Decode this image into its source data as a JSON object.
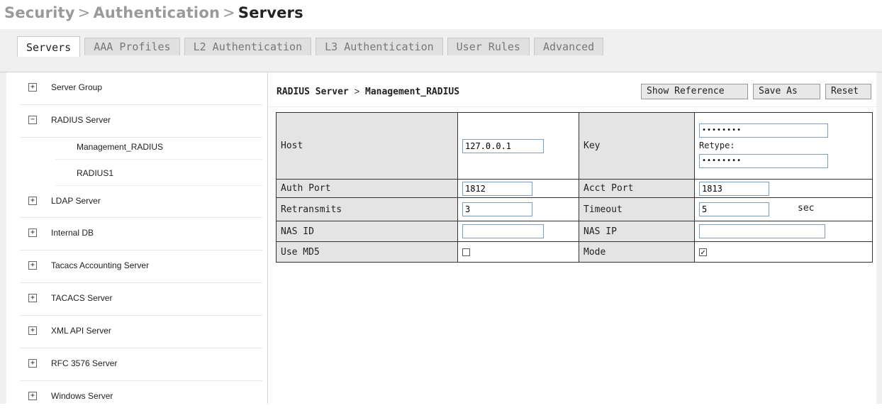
{
  "breadcrumb": {
    "part1": "Security",
    "sep1": ">",
    "part2": "Authentication",
    "sep2": ">",
    "current": "Servers"
  },
  "tabs": [
    {
      "label": "Servers",
      "active": true
    },
    {
      "label": "AAA Profiles"
    },
    {
      "label": "L2 Authentication"
    },
    {
      "label": "L3 Authentication"
    },
    {
      "label": "User Rules"
    },
    {
      "label": "Advanced"
    }
  ],
  "tree": {
    "server_group": {
      "toggle": "+",
      "label": "Server Group"
    },
    "radius_server": {
      "toggle": "−",
      "label": "RADIUS Server",
      "children": [
        "Management_RADIUS",
        "RADIUS1"
      ]
    },
    "ldap_server": {
      "toggle": "+",
      "label": "LDAP Server"
    },
    "internal_db": {
      "toggle": "+",
      "label": "Internal DB"
    },
    "tacacs_accounting": {
      "toggle": "+",
      "label": "Tacacs Accounting Server"
    },
    "tacacs_server": {
      "toggle": "+",
      "label": "TACACS Server"
    },
    "xml_api": {
      "toggle": "+",
      "label": "XML API Server"
    },
    "rfc3576": {
      "toggle": "+",
      "label": "RFC 3576 Server"
    },
    "windows": {
      "toggle": "+",
      "label": "Windows Server"
    }
  },
  "panel": {
    "title_prefix": "RADIUS Server",
    "title_arrow": ">",
    "title_name": "Management_RADIUS",
    "buttons": {
      "show_reference": "Show Reference",
      "save_as": "Save As",
      "reset": "Reset"
    }
  },
  "form": {
    "host_label": "Host",
    "host_value": "127.0.0.1",
    "key_label": "Key",
    "key_value": "••••••••",
    "retype_label": "Retype:",
    "retype_value": "••••••••",
    "auth_port_label": "Auth Port",
    "auth_port_value": "1812",
    "acct_port_label": "Acct Port",
    "acct_port_value": "1813",
    "retransmits_label": "Retransmits",
    "retransmits_value": "3",
    "timeout_label": "Timeout",
    "timeout_value": "5",
    "timeout_unit": "sec",
    "nas_id_label": "NAS ID",
    "nas_id_value": "",
    "nas_ip_label": "NAS IP",
    "nas_ip_value": "",
    "use_md5_label": "Use MD5",
    "use_md5_checked": false,
    "mode_label": "Mode",
    "mode_checked": true,
    "check_mark": "✓"
  }
}
